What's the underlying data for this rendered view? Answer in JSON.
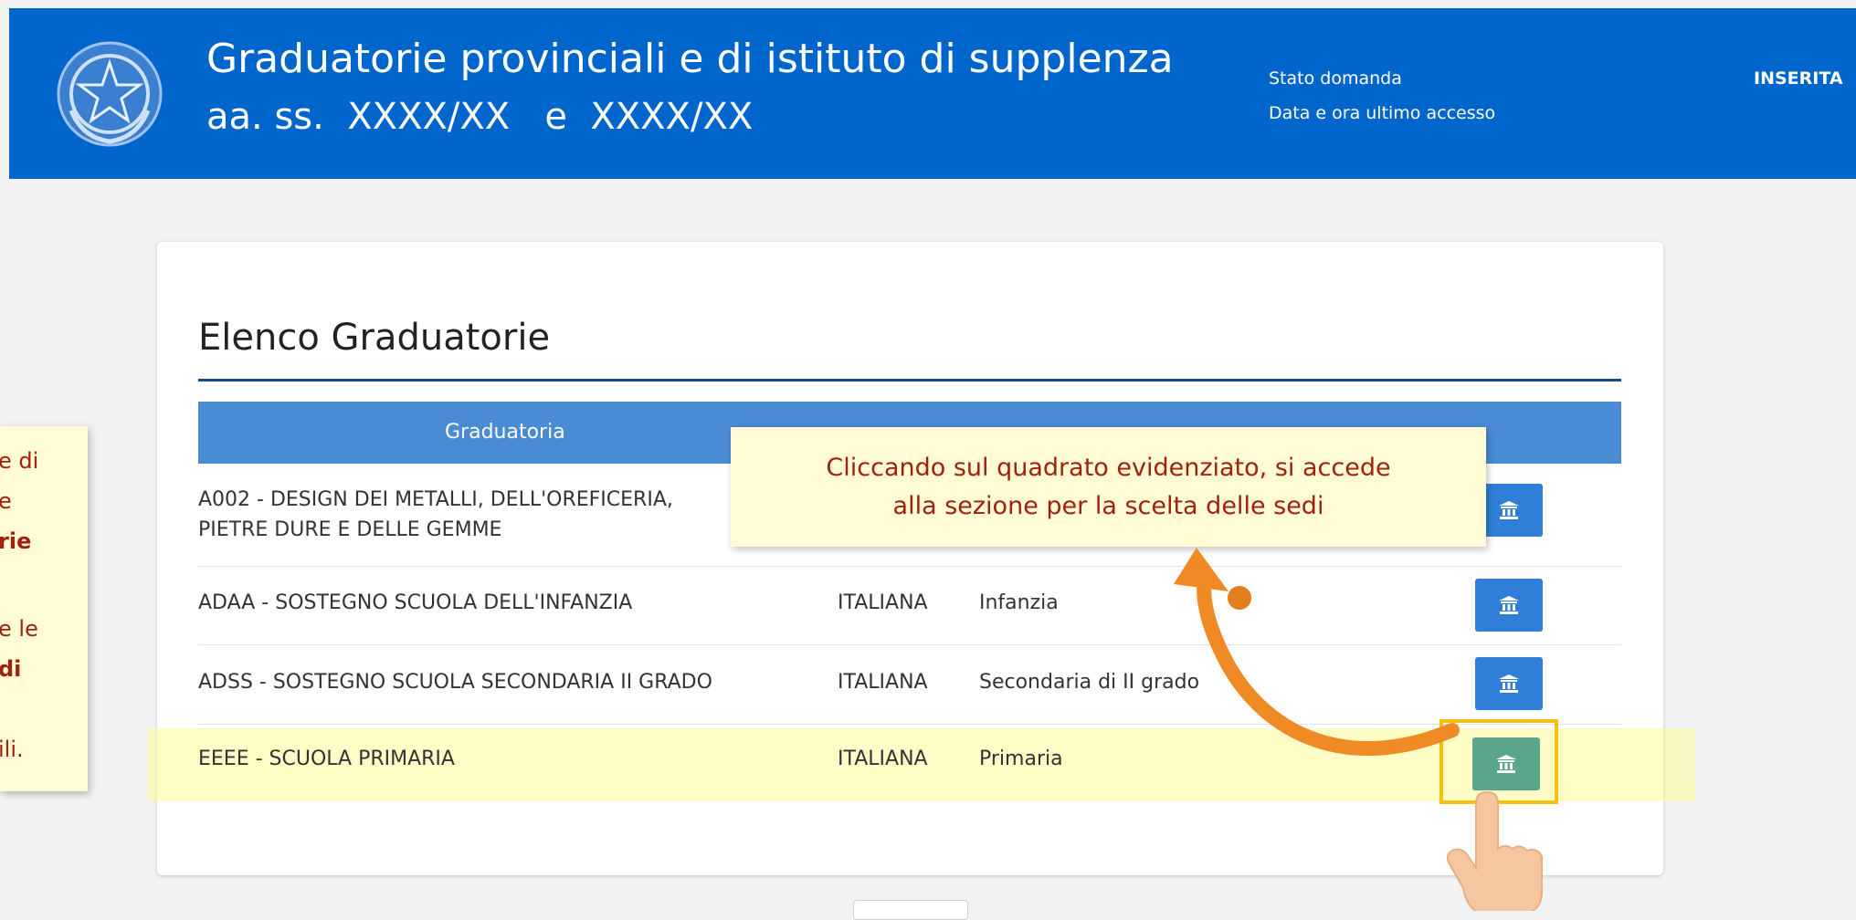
{
  "header": {
    "title": "Graduatorie provinciali e di istituto di supplenza",
    "subtitle": "aa. ss.  XXXX/XX   e  XXXX/XX",
    "status_label": "Stato domanda",
    "access_label": "Data e ora ultimo accesso",
    "status_value": "INSERITA",
    "emblem_icon": "italian-republic-emblem-icon",
    "bg_color": "#0066cc"
  },
  "card": {
    "title": "Elenco Graduatorie",
    "columns": [
      "Graduatoria"
    ],
    "rows": [
      {
        "graduatoria_line1": "A002 - DESIGN DEI METALLI, DELL'OREFICERIA,",
        "graduatoria_line2": "PIETRE DURE E DELLE GEMME",
        "lingua": "",
        "grado": "",
        "icon": "building-columns-icon"
      },
      {
        "graduatoria": "ADAA - SOSTEGNO SCUOLA DELL'INFANZIA",
        "lingua": "ITALIANA",
        "grado": "Infanzia",
        "icon": "building-columns-icon"
      },
      {
        "graduatoria": "ADSS - SOSTEGNO SCUOLA SECONDARIA II GRADO",
        "lingua": "ITALIANA",
        "grado": "Secondaria di II grado",
        "icon": "building-columns-icon"
      },
      {
        "graduatoria": "EEEE - SCUOLA PRIMARIA",
        "lingua": "ITALIANA",
        "grado": "Primaria",
        "icon": "building-columns-icon"
      }
    ],
    "button_color": "#2f7ed8",
    "highlight_button_color": "#5aa68a"
  },
  "tooltip": {
    "line1": "Cliccando sul quadrato evidenziato, si accede",
    "line2": "alla sezione per la scelta delle sedi"
  },
  "side_note": {
    "fragments": [
      "e di",
      "e",
      "rie",
      "e le",
      "di",
      "ili."
    ]
  },
  "colors": {
    "highlight_yellow": "#f4c20d",
    "arrow_orange": "#f08a24",
    "tooltip_text": "#a0210e"
  }
}
